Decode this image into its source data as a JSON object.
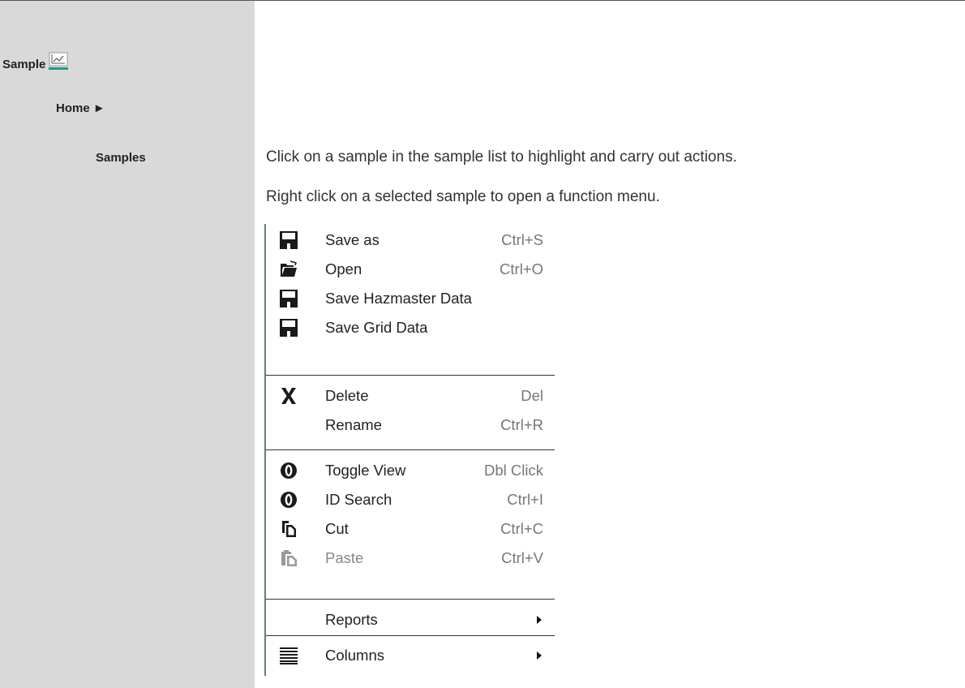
{
  "sidebar": {
    "title": "Sample",
    "title_icon": "chart-line-icon",
    "home": "Home ►",
    "samples": "Samples"
  },
  "content": {
    "line1": "Click on a sample in the sample list to highlight and carry out actions.",
    "line2": "Right click on a selected sample to open a function menu."
  },
  "menu": {
    "items": [
      {
        "label": "Save as",
        "shortcut": "Ctrl+S",
        "icon": "floppy-disk-icon"
      },
      {
        "label": "Open",
        "shortcut": "Ctrl+O",
        "icon": "folder-open-icon"
      },
      {
        "label": "Save Hazmaster Data",
        "shortcut": "",
        "icon": "floppy-disk-icon"
      },
      {
        "label": "Save Grid Data",
        "shortcut": "",
        "icon": "floppy-disk-icon"
      },
      {
        "label": "Delete",
        "shortcut": "Del",
        "icon": "delete-x-icon"
      },
      {
        "label": "Rename",
        "shortcut": "Ctrl+R",
        "icon": ""
      },
      {
        "label": "Toggle View",
        "shortcut": "Dbl Click",
        "icon": "zero-circle-icon"
      },
      {
        "label": "ID Search",
        "shortcut": "Ctrl+I",
        "icon": "zero-circle-icon"
      },
      {
        "label": "Cut",
        "shortcut": "Ctrl+C",
        "icon": "copy-icon"
      },
      {
        "label": "Paste",
        "shortcut": "Ctrl+V",
        "icon": "paste-icon",
        "disabled": true
      },
      {
        "label": "Reports",
        "shortcut": "",
        "icon": "",
        "submenu": true
      },
      {
        "label": "Columns",
        "shortcut": "",
        "icon": "columns-lines-icon",
        "submenu": true
      }
    ]
  },
  "colors": {
    "sidebar_bg": "#d9d9d9",
    "accent": "#1a9e8c",
    "menu_border": "#5a7f82"
  }
}
